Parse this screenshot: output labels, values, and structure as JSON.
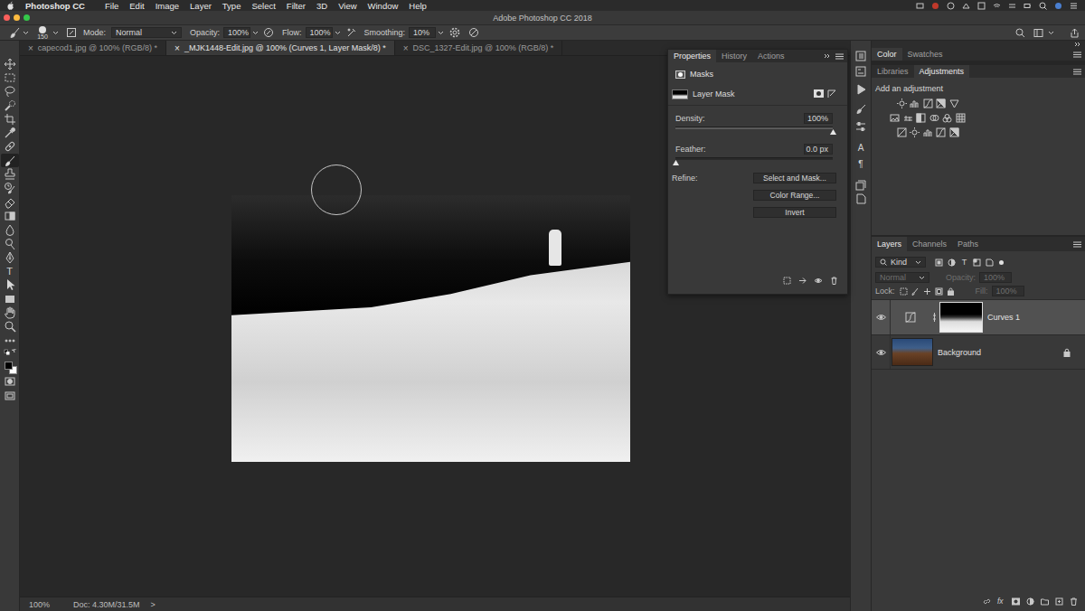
{
  "menu_bar": {
    "app": "Photoshop CC",
    "items": [
      "File",
      "Edit",
      "Image",
      "Layer",
      "Type",
      "Select",
      "Filter",
      "3D",
      "View",
      "Window",
      "Help"
    ]
  },
  "window": {
    "title": "Adobe Photoshop CC 2018"
  },
  "options_bar": {
    "brush_size": "150",
    "mode_label": "Mode:",
    "mode": "Normal",
    "opacity_label": "Opacity:",
    "opacity": "100%",
    "flow_label": "Flow:",
    "flow": "100%",
    "smoothing_label": "Smoothing:",
    "smoothing": "10%"
  },
  "doc_tabs": [
    {
      "close": "×",
      "label": "capecod1.jpg @ 100% (RGB/8) *",
      "selected": false
    },
    {
      "close": "×",
      "label": "_MJK1448-Edit.jpg @ 100% (Curves 1, Layer Mask/8) *",
      "selected": true
    },
    {
      "close": "×",
      "label": "DSC_1327-Edit.jpg @ 100% (RGB/8) *",
      "selected": false
    }
  ],
  "tools": [
    {
      "kind": "move",
      "selected": false
    },
    {
      "kind": "marquee",
      "selected": false
    },
    {
      "kind": "lasso",
      "selected": false
    },
    {
      "kind": "quickselect",
      "selected": false
    },
    {
      "kind": "crop",
      "selected": false
    },
    {
      "kind": "eyedropper",
      "selected": false
    },
    {
      "kind": "healing",
      "selected": false
    },
    {
      "kind": "brush",
      "selected": true
    },
    {
      "kind": "stamp",
      "selected": false
    },
    {
      "kind": "historybrush",
      "selected": false
    },
    {
      "kind": "eraser",
      "selected": false
    },
    {
      "kind": "gradient",
      "selected": false
    },
    {
      "kind": "blur",
      "selected": false
    },
    {
      "kind": "dodge",
      "selected": false
    },
    {
      "kind": "pen",
      "selected": false
    },
    {
      "kind": "type",
      "glyph": "T",
      "selected": false
    },
    {
      "kind": "pathselect",
      "selected": false
    },
    {
      "kind": "shape",
      "selected": false
    },
    {
      "kind": "hand",
      "selected": false
    },
    {
      "kind": "zoom",
      "selected": false
    },
    {
      "kind": "more",
      "selected": false
    },
    {
      "kind": "swap",
      "selected": false
    },
    {
      "kind": "colors",
      "selected": false,
      "swatches": [
        {
          "color": "#000000"
        },
        {
          "color": "#ffffff"
        }
      ]
    },
    {
      "kind": "quickmask",
      "selected": false
    },
    {
      "kind": "screenmode",
      "selected": false
    }
  ],
  "side_dock": [
    {
      "kind": "history"
    },
    {
      "kind": "properties"
    },
    {
      "kind": "actions"
    },
    {
      "kind": "brush"
    },
    {
      "kind": "adjust"
    },
    {
      "kind": "character",
      "glyph": "A"
    },
    {
      "kind": "paragraph",
      "glyph": "¶"
    },
    {
      "kind": "comps"
    },
    {
      "kind": "notes"
    }
  ],
  "properties": {
    "tabs": [
      {
        "label": "Properties",
        "selected": true
      },
      {
        "label": "History",
        "selected": false
      },
      {
        "label": "Actions",
        "selected": false
      }
    ],
    "section": "Masks",
    "mask_label": "Layer Mask",
    "density": {
      "label": "Density:",
      "value": "100%",
      "level": 1
    },
    "feather": {
      "label": "Feather:",
      "value": "0.0 px",
      "level": 0
    },
    "refine_label": "Refine:",
    "buttons": [
      "Select and Mask...",
      "Color Range...",
      "Invert"
    ]
  },
  "color_panel": {
    "tabs": [
      {
        "label": "Color",
        "selected": true
      },
      {
        "label": "Swatches",
        "selected": false
      }
    ]
  },
  "adjustments_panel": {
    "tabs": [
      {
        "label": "Libraries",
        "selected": false
      },
      {
        "label": "Adjustments",
        "selected": true
      }
    ],
    "heading": "Add an adjustment"
  },
  "layers_panel": {
    "tabs": [
      {
        "label": "Layers",
        "selected": true
      },
      {
        "label": "Channels",
        "selected": false
      },
      {
        "label": "Paths",
        "selected": false
      }
    ],
    "filter": "Kind",
    "type_filter_glyph": "T",
    "blend_mode": {
      "value": "Normal",
      "disabled": true
    },
    "opacity": {
      "label": "Opacity:",
      "value": "100%",
      "disabled": true
    },
    "lock_label": "Lock:",
    "fill": {
      "label": "Fill:",
      "value": "100%",
      "disabled": true
    },
    "layers": [
      {
        "name": "Curves 1",
        "kind": "adjustment",
        "selected": true,
        "visible": true,
        "locked": false
      },
      {
        "name": "Background",
        "kind": "pixel",
        "selected": false,
        "visible": true,
        "locked": true
      }
    ],
    "fx_label": "fx"
  },
  "status_bar": {
    "zoom": "100%",
    "doc": "Doc: 4.30M/31.5M",
    "arrow": ">"
  }
}
